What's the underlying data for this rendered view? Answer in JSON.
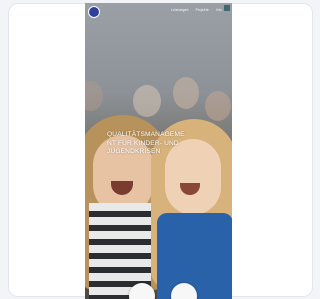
{
  "nav": {
    "links": [
      "Leistungen",
      "Projekte",
      "Info"
    ]
  },
  "hero": {
    "title_lines": [
      "QUALITÄTSMANAGEME",
      "NT FÜR KINDER- UND",
      "JUGENDKRISEN"
    ]
  },
  "colors": {
    "card_bg": "#ffffff",
    "page_bg": "#f2f4f7",
    "logo": "#2f3f9a",
    "menu_square": "#3f6b70"
  }
}
